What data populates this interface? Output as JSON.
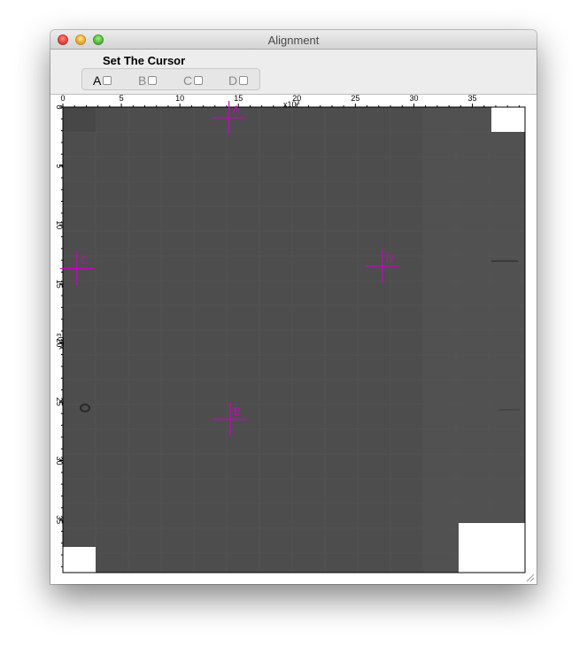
{
  "window": {
    "title": "Alignment"
  },
  "panel": {
    "title": "Set The Cursor"
  },
  "checkboxes": [
    {
      "label": "A",
      "checked": false,
      "active": true
    },
    {
      "label": "B",
      "checked": false,
      "active": false
    },
    {
      "label": "C",
      "checked": false,
      "active": false
    },
    {
      "label": "D",
      "checked": false,
      "active": false
    }
  ],
  "image_plot": {
    "x_ticks": [
      0,
      5,
      10,
      15,
      20,
      25,
      30,
      35
    ],
    "y_ticks": [
      0,
      5,
      10,
      15,
      20,
      25,
      30,
      35
    ],
    "x_range": [
      0,
      39.5
    ],
    "y_range": [
      0,
      39.5
    ],
    "x_exponent": "x10",
    "x_exponent_power": "3",
    "y_exponent": "x10",
    "y_exponent_power": "3",
    "image_color": "#4d4d4d",
    "cursor_color": "#cc00cc",
    "cursors": [
      {
        "label": "A",
        "x": 14.2,
        "y": 0.9
      },
      {
        "label": "B",
        "x": 14.3,
        "y": 26.5
      },
      {
        "label": "C",
        "x": 1.2,
        "y": 13.7
      },
      {
        "label": "D",
        "x": 27.3,
        "y": 13.5
      }
    ]
  }
}
